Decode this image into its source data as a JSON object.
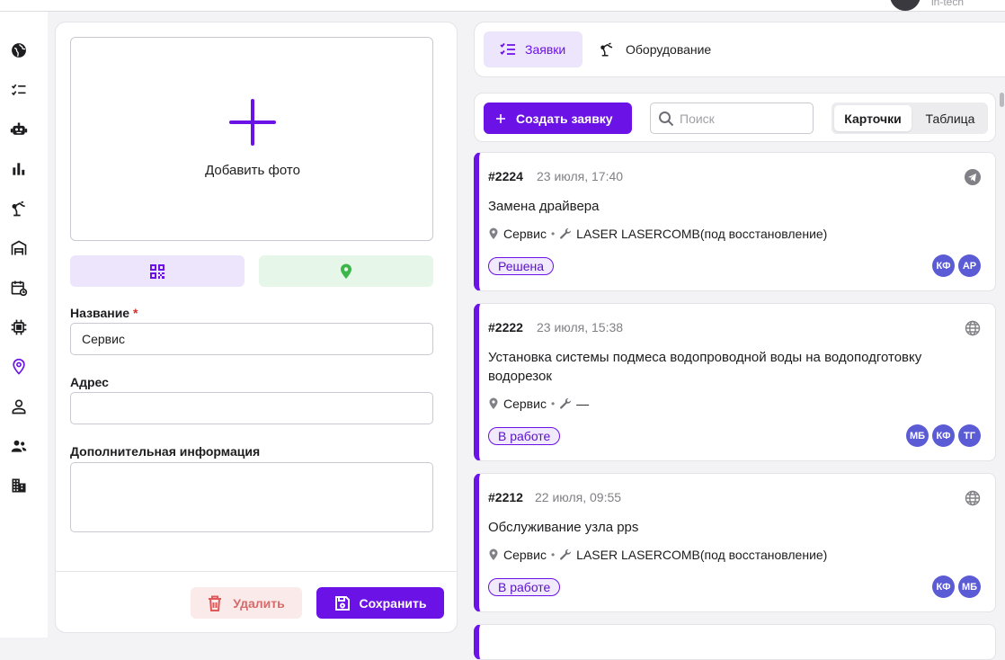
{
  "header": {
    "username": "in-tech"
  },
  "form": {
    "add_photo_label": "Добавить фото",
    "name_label": "Название",
    "name_required_mark": "*",
    "name_value": "Сервис",
    "address_label": "Адрес",
    "address_value": "",
    "extra_label": "Дополнительная информация",
    "extra_value": "",
    "delete_label": "Удалить",
    "save_label": "Сохранить"
  },
  "tabs": {
    "requests_label": "Заявки",
    "equipment_label": "Оборудование"
  },
  "toolbar": {
    "create_label": "Создать заявку",
    "search_placeholder": "Поиск",
    "view_cards_label": "Карточки",
    "view_table_label": "Таблица"
  },
  "requests": [
    {
      "number": "#2224",
      "date": "23 июля, 17:40",
      "channel": "telegram-icon",
      "title": "Замена драйвера",
      "location": "Сервис",
      "equipment": "LASER LASERCOMB(под восстановление)",
      "status": "Решена",
      "assignees": [
        "КФ",
        "АР"
      ]
    },
    {
      "number": "#2222",
      "date": "23 июля, 15:38",
      "channel": "globe-icon",
      "title": "Установка системы подмеса водопроводной воды на водоподготовку водорезок",
      "location": "Сервис",
      "equipment": "—",
      "status": "В работе",
      "assignees": [
        "МБ",
        "КФ",
        "ТГ"
      ]
    },
    {
      "number": "#2212",
      "date": "22 июля, 09:55",
      "channel": "globe-icon",
      "title": "Обслуживание узла pps",
      "location": "Сервис",
      "equipment": "LASER LASERCOMB(под восстановление)",
      "status": "В работе",
      "assignees": [
        "КФ",
        "МБ"
      ]
    }
  ],
  "colors": {
    "accent": "#6b12e6",
    "accent_light": "#ece5fb",
    "green_light": "#e6f6e9",
    "green": "#3cb64a",
    "danger_light": "#fbeaea",
    "danger": "#d76b6b",
    "avatar": "#5b5bd6"
  }
}
